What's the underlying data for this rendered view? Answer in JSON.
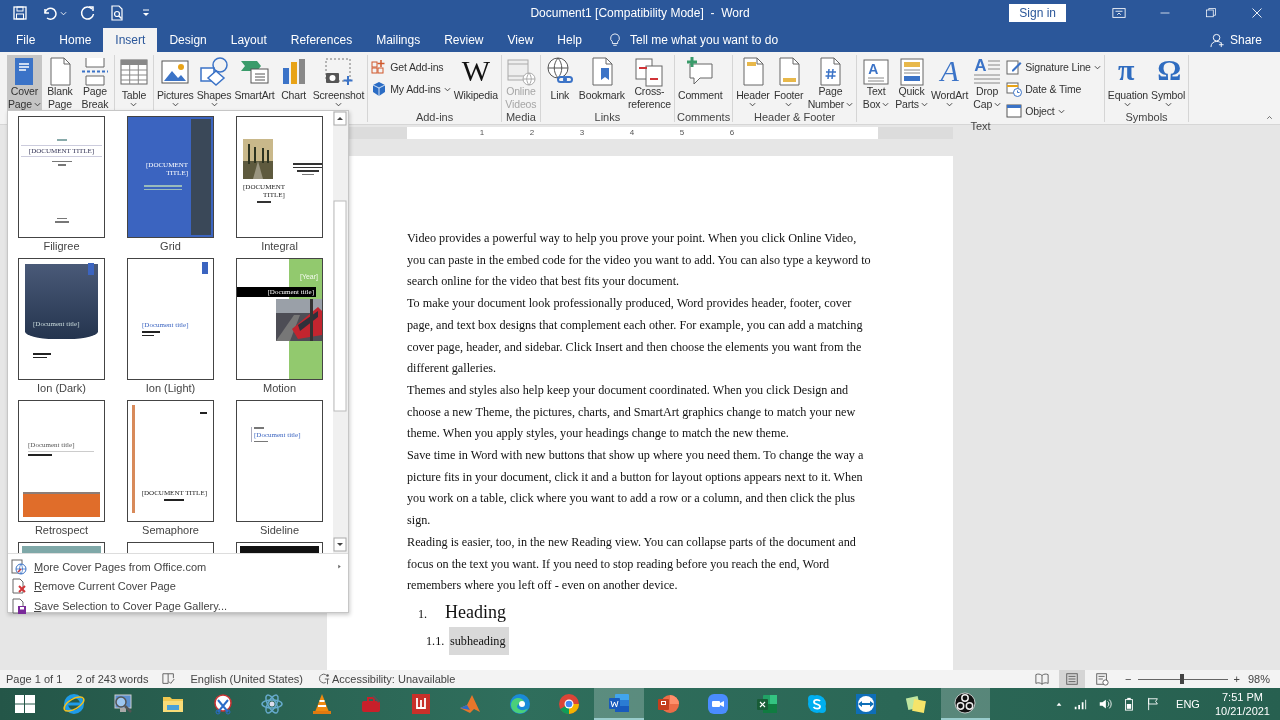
{
  "window": {
    "title": "Document1 [Compatibility Mode]  -  Word",
    "sign_in": "Sign in"
  },
  "quick_access": [
    {
      "kind": "save",
      "dropdown": false
    },
    {
      "kind": "undo",
      "dropdown": true
    },
    {
      "kind": "repeat",
      "dropdown": false
    },
    {
      "kind": "print-preview",
      "dropdown": false
    },
    {
      "kind": "customize",
      "dropdown": false
    }
  ],
  "tabs": [
    {
      "label": "File",
      "selected": false
    },
    {
      "label": "Home",
      "selected": false
    },
    {
      "label": "Insert",
      "selected": true
    },
    {
      "label": "Design",
      "selected": false
    },
    {
      "label": "Layout",
      "selected": false
    },
    {
      "label": "References",
      "selected": false
    },
    {
      "label": "Mailings",
      "selected": false
    },
    {
      "label": "Review",
      "selected": false
    },
    {
      "label": "View",
      "selected": false
    },
    {
      "label": "Help",
      "selected": false
    }
  ],
  "tell_me": "Tell me what you want to do",
  "share": "Share",
  "ribbon": {
    "groups": [
      {
        "items": [
          {
            "kind": "cover-page",
            "lines": [
              "Cover",
              "Page"
            ],
            "dropdown": true,
            "active": true,
            "disabled": false
          },
          {
            "kind": "blank-page",
            "lines": [
              "Blank",
              "Page"
            ],
            "dropdown": false,
            "active": false,
            "disabled": false
          },
          {
            "kind": "page-break",
            "lines": [
              "Page",
              "Break"
            ],
            "dropdown": false,
            "active": false,
            "disabled": false
          }
        ]
      },
      {
        "items": [
          {
            "kind": "table",
            "lines": [
              "Table"
            ],
            "dropdown": true,
            "active": false,
            "disabled": false
          }
        ]
      },
      {
        "items": [
          {
            "kind": "pictures",
            "lines": [
              "Pictures"
            ],
            "dropdown": true,
            "active": false,
            "disabled": false
          },
          {
            "kind": "shapes",
            "lines": [
              "Shapes"
            ],
            "dropdown": true,
            "active": false,
            "disabled": false
          },
          {
            "kind": "smartart",
            "lines": [
              "SmartArt"
            ],
            "dropdown": false,
            "active": false,
            "disabled": false
          },
          {
            "kind": "chart",
            "lines": [
              "Chart"
            ],
            "dropdown": false,
            "active": false,
            "disabled": false
          },
          {
            "kind": "screenshot",
            "lines": [
              "Screenshot"
            ],
            "dropdown": true,
            "active": false,
            "disabled": false
          }
        ]
      },
      {
        "label": "Add-ins",
        "items": [
          {
            "kind": "stack",
            "items": [
              {
                "kind": "get-addins",
                "label": "Get Add-ins",
                "dropdown": false
              },
              {
                "kind": "my-addins",
                "label": "My Add-ins",
                "dropdown": true
              }
            ]
          },
          {
            "kind": "wikipedia",
            "glyph": "W",
            "lines": [
              "Wikipedia"
            ],
            "dropdown": false,
            "active": false,
            "disabled": false
          }
        ]
      },
      {
        "label": "Media",
        "items": [
          {
            "kind": "online-videos",
            "lines": [
              "Online",
              "Videos"
            ],
            "dropdown": false,
            "active": false,
            "disabled": true
          }
        ]
      },
      {
        "label": "Links",
        "items": [
          {
            "kind": "link",
            "lines": [
              "Link"
            ],
            "dropdown": false,
            "active": false,
            "disabled": false
          },
          {
            "kind": "bookmark",
            "lines": [
              "Bookmark"
            ],
            "dropdown": false,
            "active": false,
            "disabled": false
          },
          {
            "kind": "cross-reference",
            "lines": [
              "Cross-",
              "reference"
            ],
            "dropdown": false,
            "active": false,
            "disabled": false
          }
        ]
      },
      {
        "label": "Comments",
        "items": [
          {
            "kind": "comment",
            "lines": [
              "Comment"
            ],
            "dropdown": false,
            "active": false,
            "disabled": false
          }
        ]
      },
      {
        "label": "Header & Footer",
        "items": [
          {
            "kind": "header",
            "lines": [
              "Header"
            ],
            "dropdown": true,
            "active": false,
            "disabled": false
          },
          {
            "kind": "footer",
            "lines": [
              "Footer"
            ],
            "dropdown": true,
            "active": false,
            "disabled": false
          },
          {
            "kind": "page-number",
            "lines": [
              "Page",
              "Number"
            ],
            "dropdown": true,
            "active": false,
            "disabled": false
          }
        ]
      },
      {
        "label": "Text",
        "items": [
          {
            "kind": "text-box",
            "glyph": "A",
            "lines": [
              "Text",
              "Box"
            ],
            "dropdown": true,
            "active": false,
            "disabled": false
          },
          {
            "kind": "quick-parts",
            "lines": [
              "Quick",
              "Parts"
            ],
            "dropdown": true,
            "active": false,
            "disabled": false
          },
          {
            "kind": "wordart",
            "glyph": "A",
            "lines": [
              "WordArt"
            ],
            "dropdown": true,
            "active": false,
            "disabled": false
          },
          {
            "kind": "drop-cap",
            "glyph": "A",
            "lines": [
              "Drop",
              "Cap"
            ],
            "dropdown": true,
            "active": false,
            "disabled": false
          },
          {
            "kind": "stack",
            "items": [
              {
                "kind": "signature-line",
                "label": "Signature Line",
                "dropdown": true
              },
              {
                "kind": "date-time",
                "label": "Date & Time",
                "dropdown": false
              },
              {
                "kind": "object",
                "label": "Object",
                "dropdown": true
              }
            ]
          }
        ]
      },
      {
        "label": "Symbols",
        "items": [
          {
            "kind": "equation",
            "glyph": "π",
            "lines": [
              "Equation"
            ],
            "dropdown": true,
            "active": false,
            "disabled": false
          },
          {
            "kind": "symbol",
            "glyph": "Ω",
            "lines": [
              "Symbol"
            ],
            "dropdown": true,
            "active": false,
            "disabled": false
          }
        ]
      }
    ]
  },
  "ruler": [
    "1",
    "2",
    "3",
    "4",
    "5",
    "6"
  ],
  "cover_page_gallery": {
    "thumbnails": [
      {
        "kind": "filigree",
        "name": "Filigree",
        "title": "[DOCUMENT TITLE]"
      },
      {
        "kind": "grid",
        "name": "Grid",
        "title": "[DOCUMENT TITLE]"
      },
      {
        "kind": "integral",
        "name": "Integral",
        "title": "[DOCUMENT TITLE]"
      },
      {
        "kind": "ion-dark",
        "name": "Ion (Dark)",
        "title": "[Document title]"
      },
      {
        "kind": "ion-light",
        "name": "Ion (Light)",
        "title": "[Document title]"
      },
      {
        "kind": "motion",
        "name": "Motion",
        "title": "[Document title]",
        "year": "[Year]"
      },
      {
        "kind": "retrospect",
        "name": "Retrospect",
        "title": "[Document title]"
      },
      {
        "kind": "semaphore",
        "name": "Semaphore",
        "title": "[DOCUMENT TITLE]"
      },
      {
        "kind": "sideline",
        "name": "Sideline",
        "title": "[Document title]"
      },
      {
        "kind": "teal-band"
      },
      {
        "kind": "plain"
      },
      {
        "kind": "dark-band"
      }
    ],
    "menu": [
      {
        "kind": "globe-page",
        "label": "More Cover Pages from Office.com",
        "submenu": true
      },
      {
        "kind": "remove-page",
        "label": "Remove Current Cover Page",
        "submenu": false
      },
      {
        "kind": "save-page",
        "label": "Save Selection to Cover Page Gallery...",
        "submenu": false
      }
    ]
  },
  "document": {
    "paragraphs": [
      "Video provides a powerful way to help you prove your point. When you click Online Video, you can paste in the embed code for the video you want to add. You can also type a keyword to search online for the video that best fits your document.",
      "To make your document look professionally produced, Word provides header, footer, cover page, and text box designs that complement each other. For example, you can add a matching cover page, header, and sidebar. Click Insert and then choose the elements you want from the different galleries.",
      "Themes and styles also help keep your document coordinated. When you click Design and choose a new Theme, the pictures, charts, and SmartArt graphics change to match your new theme. When you apply styles, your headings change to match the new theme.",
      "Save time in Word with new buttons that show up where you need them. To change the way a picture fits in your document, click it and a button for layout options appears next to it. When you work on a table, click where you want to add a row or a column, and then click the plus sign.",
      "Reading is easier, too, in the new Reading view. You can collapse parts of the document and focus on the text you want. If you need to stop reading before you reach the end, Word remembers where you left off - even on another device."
    ],
    "list": [
      {
        "number": "1.",
        "text": "Heading",
        "highlighted": false,
        "children": [
          {
            "number": "1.1.",
            "text": "subheading",
            "highlighted": true
          }
        ]
      }
    ]
  },
  "status_bar": {
    "page": "Page 1 of 1",
    "words": "2 of 243 words",
    "language": "English (United States)",
    "accessibility": "Accessibility: Unavailable",
    "views": [
      {
        "kind": "read",
        "selected": false
      },
      {
        "kind": "print",
        "selected": true
      },
      {
        "kind": "web",
        "selected": false
      }
    ],
    "zoom": {
      "minus": "−",
      "plus": "+",
      "level": 0.49,
      "reading": "98%"
    }
  },
  "taskbar": {
    "apps": [
      {
        "kind": "start",
        "active": false
      },
      {
        "kind": "ie",
        "active": false
      },
      {
        "kind": "magnifier",
        "active": false
      },
      {
        "kind": "folder",
        "active": false
      },
      {
        "kind": "scissors",
        "active": false
      },
      {
        "kind": "atom",
        "active": false
      },
      {
        "kind": "cone",
        "active": false
      },
      {
        "kind": "toolbox",
        "active": false
      },
      {
        "kind": "red-app",
        "active": false
      },
      {
        "kind": "peak",
        "active": false
      },
      {
        "kind": "edge",
        "active": false
      },
      {
        "kind": "chrome",
        "active": false
      },
      {
        "kind": "word",
        "active": true
      },
      {
        "kind": "powerpoint",
        "active": false
      },
      {
        "kind": "zoom",
        "active": false
      },
      {
        "kind": "excel",
        "active": false
      },
      {
        "kind": "skype",
        "active": false
      },
      {
        "kind": "teamviewer",
        "active": false
      },
      {
        "kind": "sticky",
        "active": false
      },
      {
        "kind": "obs",
        "active": true
      }
    ],
    "tray": {
      "language": "ENG",
      "time": "7:51 PM",
      "date": "10/21/2021"
    }
  }
}
